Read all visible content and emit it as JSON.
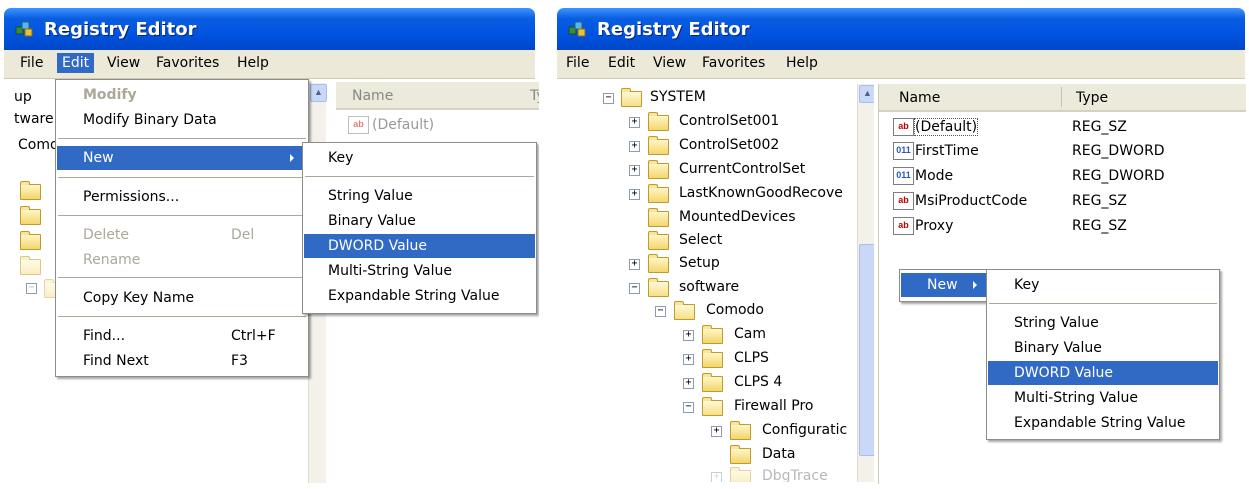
{
  "left_window": {
    "title": "Registry Editor",
    "menu": [
      "File",
      "Edit",
      "View",
      "Favorites",
      "Help"
    ],
    "tree_fragments": [
      "up",
      "tware",
      "Como"
    ],
    "list_header_name": "Name",
    "list_header_type_fragment": "Ty",
    "list_default": "(Default)",
    "edit_menu": {
      "modify": "Modify",
      "modify_binary": "Modify Binary Data",
      "new": "New",
      "permissions": "Permissions...",
      "delete": "Delete",
      "delete_shortcut": "Del",
      "rename": "Rename",
      "copy_key_name": "Copy Key Name",
      "find": "Find...",
      "find_shortcut": "Ctrl+F",
      "find_next": "Find Next",
      "find_next_shortcut": "F3"
    },
    "new_submenu": {
      "key": "Key",
      "string": "String Value",
      "binary": "Binary Value",
      "dword": "DWORD Value",
      "multi": "Multi-String Value",
      "expandable": "Expandable String Value"
    }
  },
  "right_window": {
    "title": "Registry Editor",
    "menu": [
      "File",
      "Edit",
      "View",
      "Favorites",
      "Help"
    ],
    "tree": {
      "system": "SYSTEM",
      "cs001": "ControlSet001",
      "cs002": "ControlSet002",
      "ccs": "CurrentControlSet",
      "lkg": "LastKnownGoodRecove",
      "mounted": "MountedDevices",
      "select": "Select",
      "setup": "Setup",
      "software": "software",
      "comodo": "Comodo",
      "cam": "Cam",
      "clps": "CLPS",
      "clps4": "CLPS 4",
      "firewall": "Firewall Pro",
      "config": "Configuratic",
      "data": "Data",
      "dbgtrace": "DbgTrace"
    },
    "list": {
      "header_name": "Name",
      "header_type": "Type",
      "rows": [
        {
          "icon": "ab",
          "name": "(Default)",
          "type": "REG_SZ"
        },
        {
          "icon": "011",
          "name": "FirstTime",
          "type": "REG_DWORD"
        },
        {
          "icon": "011",
          "name": "Mode",
          "type": "REG_DWORD"
        },
        {
          "icon": "ab",
          "name": "MsiProductCode",
          "type": "REG_SZ"
        },
        {
          "icon": "ab",
          "name": "Proxy",
          "type": "REG_SZ"
        }
      ]
    },
    "context_new": "New",
    "new_submenu": {
      "key": "Key",
      "string": "String Value",
      "binary": "Binary Value",
      "dword": "DWORD Value",
      "multi": "Multi-String Value",
      "expandable": "Expandable String Value"
    }
  },
  "colors": {
    "title_blue": "#0054e3",
    "highlight": "#316ac5",
    "menubar": "#ece9d8"
  }
}
